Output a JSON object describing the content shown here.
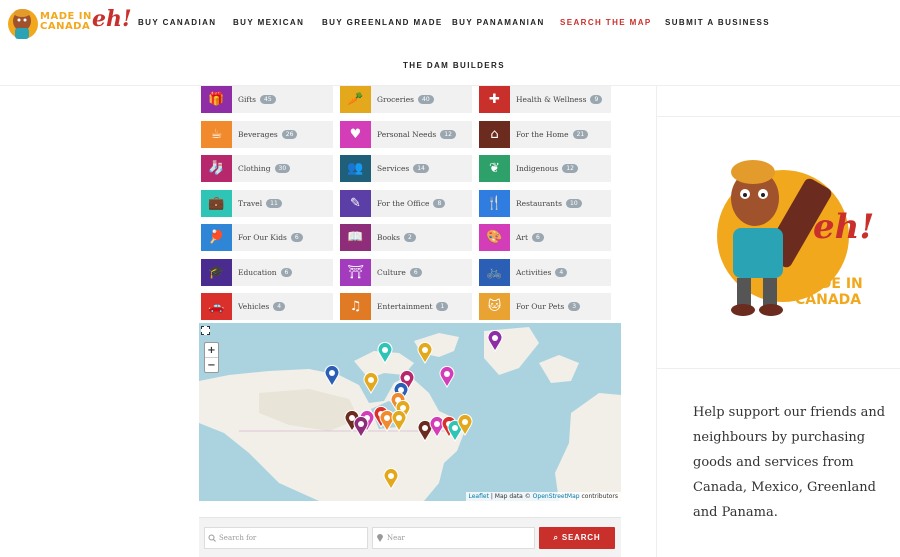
{
  "logo": {
    "line1": "MADE IN",
    "line2": "CANADA",
    "eh": "eh!"
  },
  "nav": [
    {
      "label": "BUY CANADIAN"
    },
    {
      "label": "BUY MEXICAN"
    },
    {
      "label": "BUY GREENLAND MADE"
    },
    {
      "label": "BUY PANAMANIAN"
    },
    {
      "label": "SEARCH THE MAP",
      "active": true
    },
    {
      "label": "SUBMIT A BUSINESS"
    },
    {
      "label": "THE DAM BUILDERS"
    }
  ],
  "categories": [
    {
      "label": "Gifts",
      "count": "45",
      "icon": "gift-icon",
      "color": "#8e2da6",
      "glyph": "🎁"
    },
    {
      "label": "Groceries",
      "count": "40",
      "icon": "carrot-icon",
      "color": "#e3a81c",
      "glyph": "🥕"
    },
    {
      "label": "Health & Wellness",
      "count": "9",
      "icon": "first-aid-icon",
      "color": "#c9302c",
      "glyph": "✚"
    },
    {
      "label": "Beverages",
      "count": "26",
      "icon": "mug-icon",
      "color": "#f08a2c",
      "glyph": "☕"
    },
    {
      "label": "Personal Needs",
      "count": "12",
      "icon": "heart-icon",
      "color": "#d43db8",
      "glyph": "♥"
    },
    {
      "label": "For the Home",
      "count": "21",
      "icon": "home-icon",
      "color": "#6b2b1f",
      "glyph": "⌂"
    },
    {
      "label": "Clothing",
      "count": "30",
      "icon": "socks-icon",
      "color": "#b6276b",
      "glyph": "🧦"
    },
    {
      "label": "Services",
      "count": "14",
      "icon": "people-icon",
      "color": "#1f5f7a",
      "glyph": "👥"
    },
    {
      "label": "Indigenous",
      "count": "12",
      "icon": "leaf-icon",
      "color": "#2ea06a",
      "glyph": "❦"
    },
    {
      "label": "Travel",
      "count": "11",
      "icon": "suitcase-icon",
      "color": "#2ec4b6",
      "glyph": "💼"
    },
    {
      "label": "For the Office",
      "count": "8",
      "icon": "document-icon",
      "color": "#5b3fa6",
      "glyph": "✎"
    },
    {
      "label": "Restaurants",
      "count": "10",
      "icon": "fork-knife-icon",
      "color": "#2f7de1",
      "glyph": "🍴"
    },
    {
      "label": "For Our Kids",
      "count": "6",
      "icon": "ping-pong-icon",
      "color": "#2f86d6",
      "glyph": "🏓"
    },
    {
      "label": "Books",
      "count": "2",
      "icon": "book-icon",
      "color": "#8e2d7a",
      "glyph": "📖"
    },
    {
      "label": "Art",
      "count": "6",
      "icon": "palette-icon",
      "color": "#d43db8",
      "glyph": "🎨"
    },
    {
      "label": "Education",
      "count": "6",
      "icon": "graduation-cap-icon",
      "color": "#4a2c91",
      "glyph": "🎓"
    },
    {
      "label": "Culture",
      "count": "6",
      "icon": "torii-icon",
      "color": "#a33bbd",
      "glyph": "⛩"
    },
    {
      "label": "Activities",
      "count": "4",
      "icon": "bicycle-icon",
      "color": "#2a5fb5",
      "glyph": "🚲"
    },
    {
      "label": "Vehicles",
      "count": "4",
      "icon": "car-icon",
      "color": "#d9302c",
      "glyph": "🚗"
    },
    {
      "label": "Entertainment",
      "count": "1",
      "icon": "music-note-icon",
      "color": "#e07a25",
      "glyph": "♫"
    },
    {
      "label": "For Our Pets",
      "count": "3",
      "icon": "cat-icon",
      "color": "#e8a332",
      "glyph": "🐱"
    }
  ],
  "map": {
    "zoom_in": "+",
    "zoom_out": "−",
    "attribution_leaflet": "Leaflet",
    "attribution_sep": " | Map data © ",
    "attribution_osm": "OpenStreetMap",
    "attribution_tail": " contributors"
  },
  "search": {
    "for_placeholder": "Search for",
    "near_placeholder": "Near",
    "button": "SEARCH"
  },
  "sidebar": {
    "text": "Help support our friends and neighbours by purchasing goods and services from Canada, Mexico, Greenland and Panama."
  },
  "colors": {
    "accent": "#c9302c",
    "water": "#aad3df",
    "land": "#f2efe9"
  }
}
